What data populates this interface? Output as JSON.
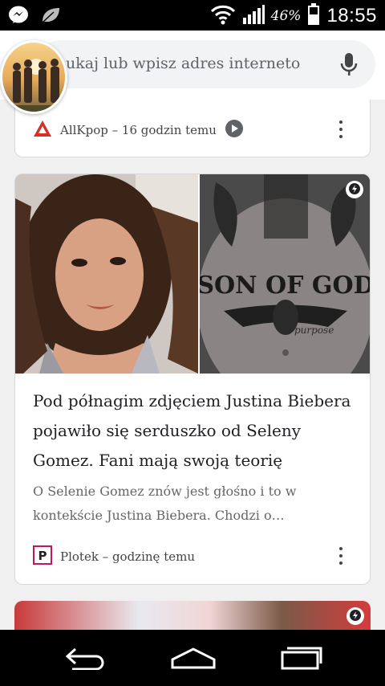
{
  "status_bar": {
    "battery_percent": "46%",
    "time": "18:55",
    "icons": [
      "messenger-icon",
      "leaf-icon",
      "wifi-icon",
      "signal-icon",
      "battery-icon"
    ]
  },
  "search": {
    "placeholder": "ukaj lub wpisz adres interneto"
  },
  "top_card": {
    "source": "AllKpop",
    "time": "16 godzin temu",
    "source_line": "AllKpop – 16 godzin temu",
    "source_icon": "allkpop-logo-icon",
    "accent": "#d93025"
  },
  "article_card": {
    "headline": "Pod półnagim zdjęciem Justina Biebera pojawiło się serduszko od Seleny Gomez. Fani mają swoją teorię",
    "snippet": "O Selenie Gomez znów jest głośno i to w kontekście Justina Biebera. Chodzi o…",
    "source": "Plotek",
    "time": "godzinę temu",
    "source_line": "Plotek – godzinę temu",
    "source_icon": "plotek-logo-icon",
    "tattoo_text": "SON OF GOD",
    "tattoo_script": "purpose",
    "source_color": "#c2185b"
  },
  "nav_bar": {
    "buttons": [
      "back-icon",
      "home-icon",
      "recents-icon"
    ]
  }
}
